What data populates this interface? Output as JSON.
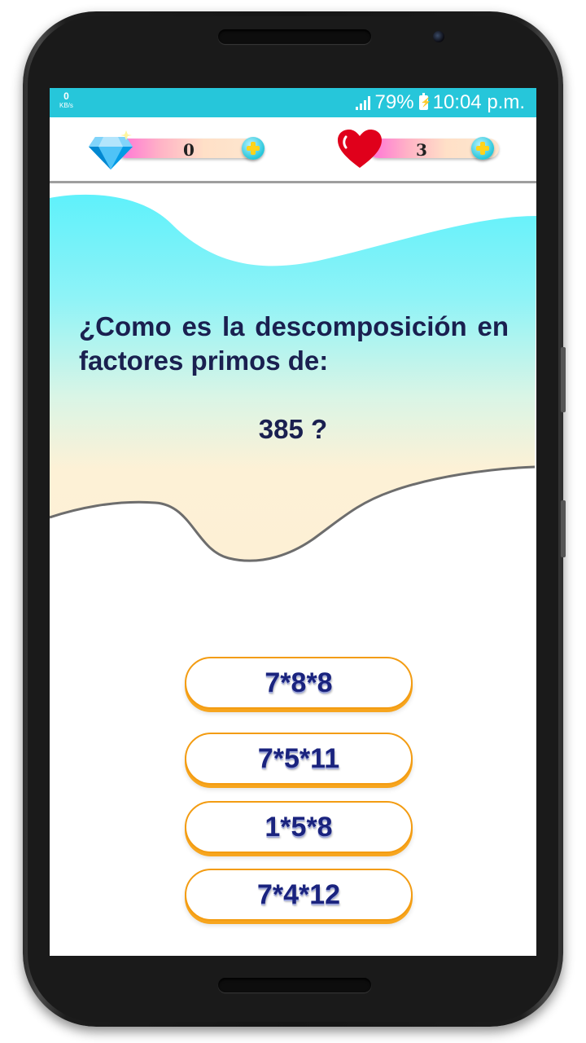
{
  "status_bar": {
    "net_speed_value": "0",
    "net_speed_unit": "KB/s",
    "battery_percent": "79%",
    "time": "10:04 p.m."
  },
  "counters": {
    "diamonds": "0",
    "lives": "3"
  },
  "question": {
    "text": "¿Como es la descomposición en factores primos de:",
    "number": "385 ?"
  },
  "answers": [
    "7*8*8",
    "7*5*11",
    "1*5*8",
    "7*4*12"
  ],
  "colors": {
    "status_bar": "#26c6da",
    "question_text": "#1a2050",
    "answer_border": "#f39c12",
    "answer_text": "#1a237e"
  }
}
